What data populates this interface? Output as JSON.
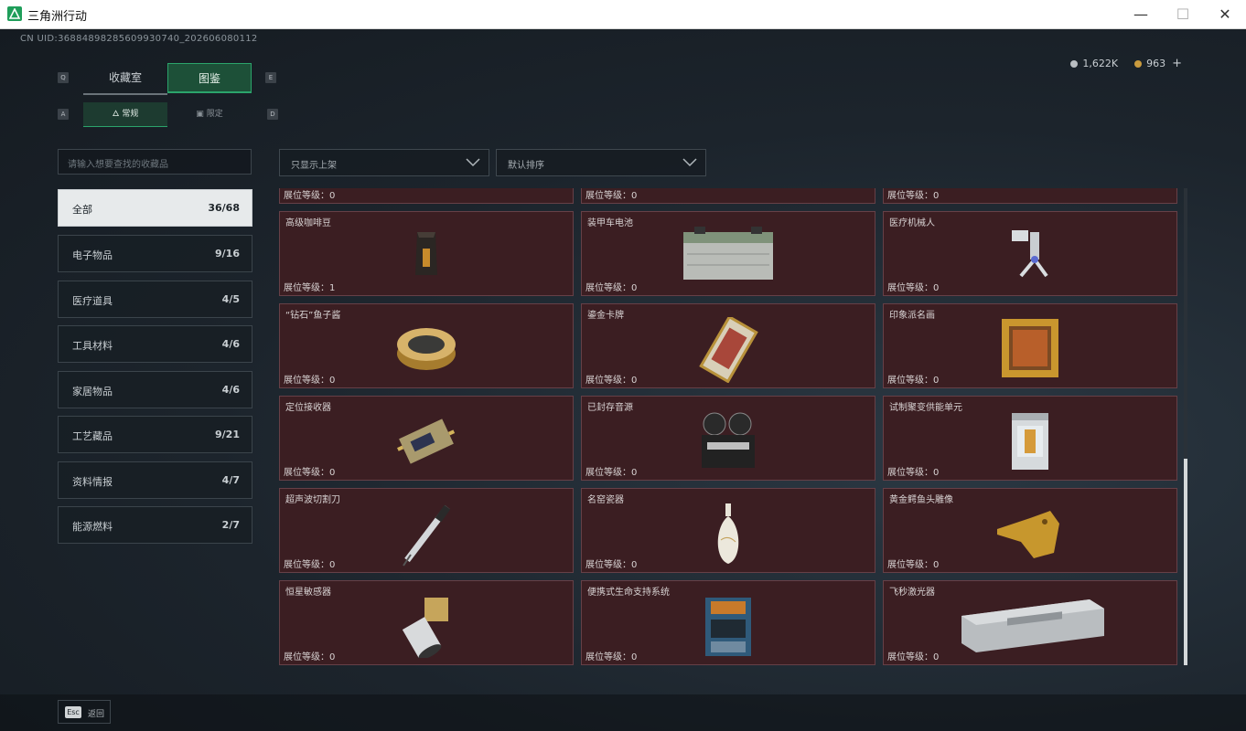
{
  "window": {
    "title": "三角洲行动",
    "minimize": "—",
    "maximize": "☐",
    "close": "✕"
  },
  "uid": "CN UID:36884898285609930740_202606080112",
  "currency": {
    "silver": "1,622K",
    "gold": "963",
    "add": "+"
  },
  "keys": {
    "prev_tab": "Q",
    "next_tab": "E",
    "prev_sub": "A",
    "next_sub": "D"
  },
  "tabs": [
    {
      "label": "收藏室"
    },
    {
      "label": "图鉴"
    }
  ],
  "subtabs": [
    {
      "label": "常规"
    },
    {
      "label": "限定"
    }
  ],
  "search": {
    "placeholder": "请输入想要查找的收藏品"
  },
  "filters": {
    "display": "只显示上架",
    "sort": "默认排序"
  },
  "categories": [
    {
      "name": "全部",
      "count": "36/68"
    },
    {
      "name": "电子物品",
      "count": "9/16"
    },
    {
      "name": "医疗道具",
      "count": "4/5"
    },
    {
      "name": "工具材料",
      "count": "4/6"
    },
    {
      "name": "家居物品",
      "count": "4/6"
    },
    {
      "name": "工艺藏品",
      "count": "9/21"
    },
    {
      "name": "资料情报",
      "count": "4/7"
    },
    {
      "name": "能源燃料",
      "count": "2/7"
    }
  ],
  "level_prefix": "展位等级：",
  "partial_row": [
    "0",
    "0",
    "0"
  ],
  "items": [
    {
      "name": "高级咖啡豆",
      "level": "1",
      "icon": "coffee-bag-icon"
    },
    {
      "name": "装甲车电池",
      "level": "0",
      "icon": "battery-icon"
    },
    {
      "name": "医疗机械人",
      "level": "0",
      "icon": "robot-arm-icon"
    },
    {
      "name": "“钻石”鱼子酱",
      "level": "0",
      "icon": "caviar-tin-icon"
    },
    {
      "name": "鎏金卡牌",
      "level": "0",
      "icon": "gold-card-icon"
    },
    {
      "name": "印象派名画",
      "level": "0",
      "icon": "framed-painting-icon"
    },
    {
      "name": "定位接收器",
      "level": "0",
      "icon": "receiver-icon"
    },
    {
      "name": "已封存音源",
      "level": "0",
      "icon": "reel-recorder-icon"
    },
    {
      "name": "试制聚变供能单元",
      "level": "0",
      "icon": "fusion-cell-icon"
    },
    {
      "name": "超声波切割刀",
      "level": "0",
      "icon": "ultrasonic-cutter-icon"
    },
    {
      "name": "名窑瓷器",
      "level": "0",
      "icon": "porcelain-vase-icon"
    },
    {
      "name": "黄金鳄鱼头雕像",
      "level": "0",
      "icon": "gold-crocodile-icon"
    },
    {
      "name": "恒星敏感器",
      "level": "0",
      "icon": "star-sensor-icon"
    },
    {
      "name": "便携式生命支持系统",
      "level": "0",
      "icon": "life-support-icon"
    },
    {
      "name": "飞秒激光器",
      "level": "0",
      "icon": "laser-box-icon"
    }
  ],
  "footer": {
    "esc_key": "Esc",
    "back_label": "返回"
  },
  "colors": {
    "card_bg": "#3b1e22",
    "card_border": "#664047",
    "accent_green": "#27a46a"
  }
}
